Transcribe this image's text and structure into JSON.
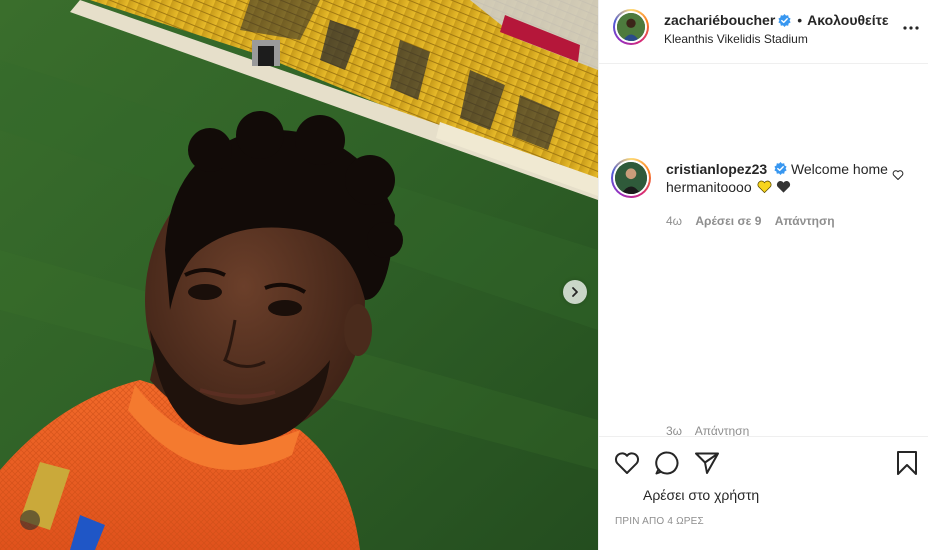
{
  "post": {
    "username": "zachariéboucher",
    "follow_label": "Ακολουθείτε",
    "location": "Kleanthis Vikelidis Stadium",
    "more_icon": "more-options-icon",
    "verified_icon": "verified-badge-icon"
  },
  "photo": {
    "next_icon": "chevron-right-icon"
  },
  "comments": [
    {
      "username": "cristianlopez23",
      "text": "Welcome home hermanitoooo",
      "emojis": [
        "yellow-heart-icon",
        "black-heart-icon"
      ],
      "time": "4ω",
      "likes": "Αρέσει σε 9",
      "reply": "Απάντηση"
    }
  ],
  "partial_comment": {
    "time": "3ω",
    "reply": "Απάντηση"
  },
  "actions": {
    "like_icon": "heart-icon",
    "comment_icon": "comment-icon",
    "share_icon": "paper-plane-icon",
    "save_icon": "bookmark-icon",
    "likes_text": "Αρέσει στο χρήστη",
    "timestamp": "ΠΡΙΝ ΑΠΟ 4 ΩΡΕΣ"
  },
  "colors": {
    "verified": "#3897f0",
    "muted_text": "#8e8e8e",
    "primary_text": "#262626",
    "yellow_heart": "#f7d51d",
    "black_heart": "#333333"
  }
}
